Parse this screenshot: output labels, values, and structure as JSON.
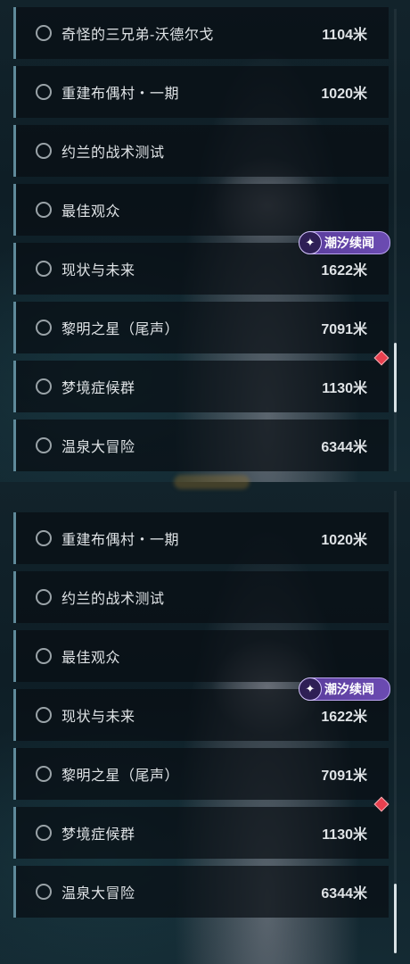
{
  "screens": [
    {
      "items": [
        {
          "name": "奇怪的三兄弟-沃德尔戈",
          "distance": "1104米"
        },
        {
          "name": "重建布偶村・一期",
          "distance": "1020米"
        },
        {
          "name": "约兰的战术测试",
          "distance": ""
        },
        {
          "name": "最佳观众",
          "distance": ""
        },
        {
          "name": "现状与未来",
          "distance": "1622米",
          "tag": "潮汐续闻"
        },
        {
          "name": "黎明之星（尾声）",
          "distance": "7091米"
        },
        {
          "name": "梦境症候群",
          "distance": "1130米",
          "marker": true
        },
        {
          "name": "温泉大冒险",
          "distance": "6344米"
        }
      ],
      "scroll_position": 0.85
    },
    {
      "items": [
        {
          "name": "重建布偶村・一期",
          "distance": "1020米"
        },
        {
          "name": "约兰的战术测试",
          "distance": ""
        },
        {
          "name": "最佳观众",
          "distance": ""
        },
        {
          "name": "现状与未来",
          "distance": "1622米",
          "tag": "潮汐续闻"
        },
        {
          "name": "黎明之星（尾声）",
          "distance": "7091米"
        },
        {
          "name": "梦境症候群",
          "distance": "1130米",
          "marker": true
        },
        {
          "name": "温泉大冒险",
          "distance": "6344米"
        }
      ],
      "scroll_position": 1.0
    }
  ],
  "tag_icon": "sparkle-icon",
  "colors": {
    "accent": "#5f8a9a",
    "tag": "#6b4bb2",
    "marker": "#e8404f"
  }
}
